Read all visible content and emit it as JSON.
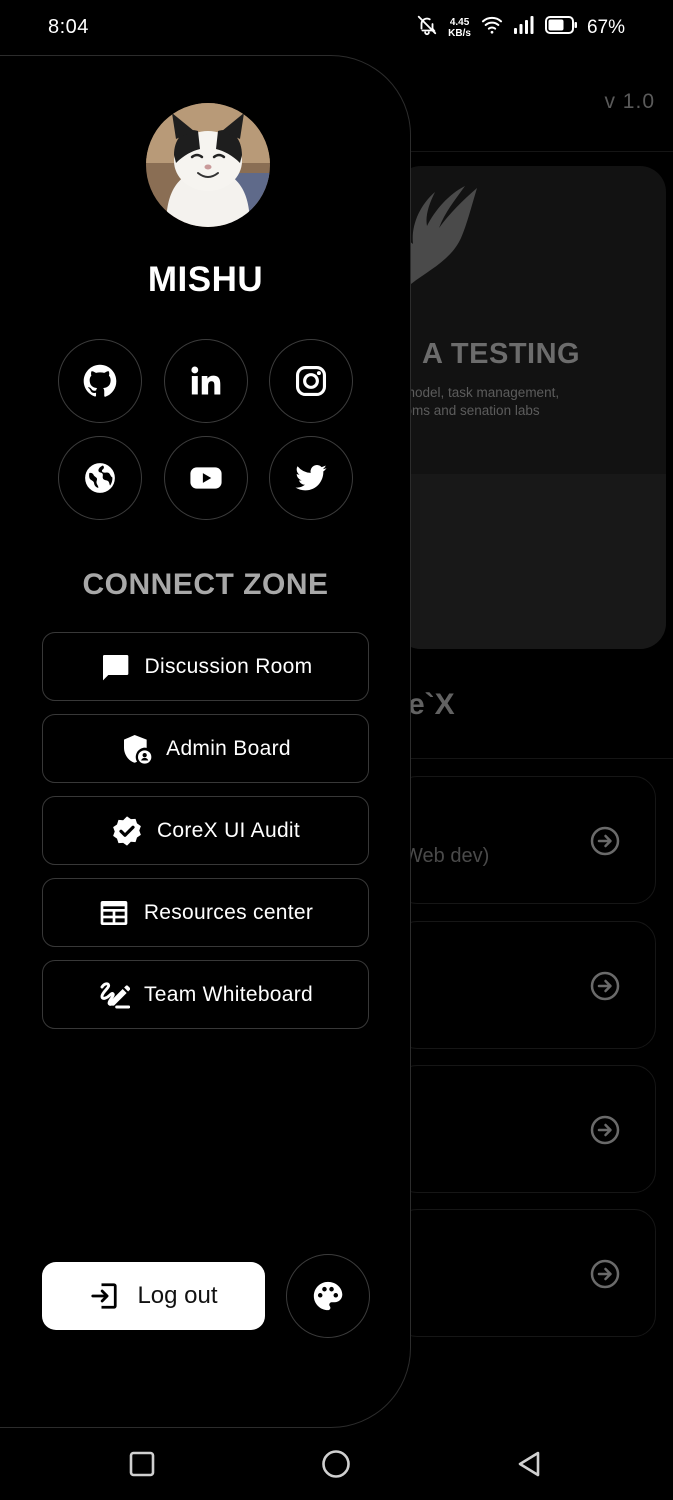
{
  "status_bar": {
    "time": "8:04",
    "net_speed_value": "4.45",
    "net_speed_unit": "KB/s",
    "battery_percent": "67%",
    "icons": [
      "mute-bell-icon",
      "wifi-icon",
      "signal-icon",
      "battery-icon"
    ]
  },
  "background_app": {
    "version": "v 1.0",
    "hero_title": "A TESTING",
    "hero_description": "l model, task management,\nooms and senation labs",
    "section_title": "e`X",
    "cards": [
      {
        "text": "Web dev)"
      },
      {
        "text": ""
      },
      {
        "text": ""
      },
      {
        "text": ""
      }
    ]
  },
  "drawer": {
    "user_name": "MISHU",
    "social_links": [
      {
        "icon": "github-icon"
      },
      {
        "icon": "linkedin-icon"
      },
      {
        "icon": "instagram-icon"
      },
      {
        "icon": "globe-icon"
      },
      {
        "icon": "youtube-icon"
      },
      {
        "icon": "twitter-icon"
      }
    ],
    "zone_title": "CONNECT ZONE",
    "menu": [
      {
        "label": "Discussion Room",
        "icon": "chat-icon"
      },
      {
        "label": "Admin Board",
        "icon": "shield-user-icon"
      },
      {
        "label": "CoreX UI Audit",
        "icon": "verified-badge-icon"
      },
      {
        "label": "Resources center",
        "icon": "resources-icon"
      },
      {
        "label": "Team Whiteboard",
        "icon": "draw-icon"
      }
    ],
    "logout_label": "Log out",
    "theme_icon": "palette-icon"
  },
  "nav_bar": {
    "icons": [
      "recents-icon",
      "home-icon",
      "back-icon"
    ]
  },
  "colors": {
    "background": "#000000",
    "drawer_border": "#2c2c2c",
    "zone_title": "#a8a8a8",
    "logout_background": "#ffffff"
  }
}
